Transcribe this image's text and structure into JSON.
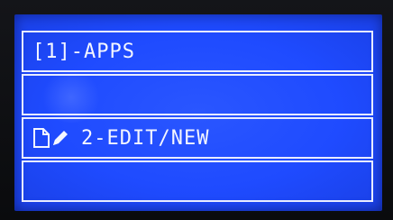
{
  "menu": {
    "items": [
      {
        "label": "[1]-APPS"
      },
      {
        "label": ""
      },
      {
        "label": "2-EDIT/NEW",
        "icons": [
          "document-icon",
          "pencil-icon"
        ]
      },
      {
        "label": ""
      }
    ]
  },
  "colors": {
    "screen_background": "#1f4bff",
    "text_and_border": "#f4f6ff",
    "bezel": "#0c0d10"
  }
}
